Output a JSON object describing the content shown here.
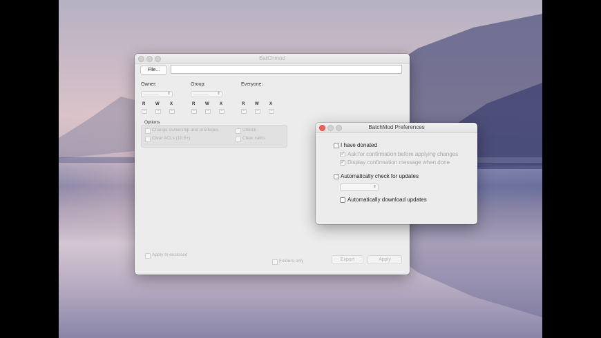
{
  "main_window": {
    "title": "BatChmod",
    "file_button": "File...",
    "path_value": "",
    "owner_label": "Owner:",
    "group_label": "Group:",
    "everyone_label": "Everyone:",
    "owner_select": "-----------",
    "group_select": "-----------",
    "rwx": {
      "r": "R",
      "w": "W",
      "x": "X"
    },
    "mini_value": "–",
    "options_label": "Options",
    "options": {
      "change_ownership": "Change ownership and privileges",
      "unlock": "Unlock",
      "clear_acls": "Clear ACLs (10.5+)",
      "clear_xattrs": "Clear xattrs"
    },
    "apply_enclosed": "Apply to enclosed",
    "folders_only": "Folders only",
    "export_button": "Export",
    "apply_button": "Apply"
  },
  "prefs_window": {
    "title": "BatchMod Preferences",
    "donated": {
      "label": "I have donated",
      "checked": false
    },
    "ask_confirm": {
      "label": "Ask for confirmation before applying changes",
      "checked": true
    },
    "display_confirm": {
      "label": "Display confirmation message when done",
      "checked": true
    },
    "auto_check": {
      "label": "Automatically check for updates",
      "checked": false
    },
    "interval_select": "",
    "auto_download": {
      "label": "Automatically download updates",
      "checked": false
    }
  },
  "colors": {
    "close_red": "#fc5e57",
    "window_bg": "#ececec"
  },
  "icons": [
    "close-icon",
    "minimize-icon",
    "zoom-icon",
    "popup-arrows-icon",
    "checkmark-icon"
  ]
}
